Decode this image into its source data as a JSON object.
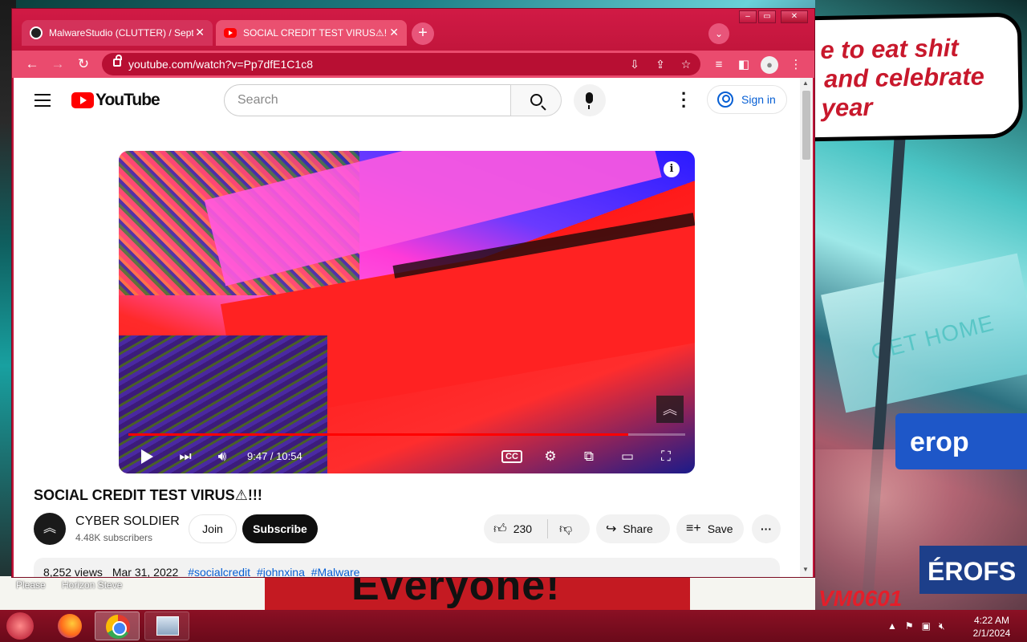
{
  "desktop": {
    "bubble_lines": [
      "e to eat shit",
      "and celebrate",
      "year"
    ],
    "billboard_text": "GET HOME",
    "sign_text_1": "erop",
    "sign_text_2": "ÉROFS",
    "banner_text": "Everyone!",
    "corner_text": "VM0601",
    "icon_labels": [
      "Please",
      "Horizon Steve"
    ]
  },
  "browser": {
    "tabs": [
      {
        "label": "MalwareStudio (CLUTTER) / Sept..."
      },
      {
        "label": "SOCIAL CREDIT TEST VIRUS⚠!!! -"
      }
    ],
    "new_tab_label": "+",
    "url": "youtube.com/watch?v=Pp7dfE1C1c8"
  },
  "youtube": {
    "logo_text": "YouTube",
    "search_placeholder": "Search",
    "sign_in_label": "Sign in",
    "player": {
      "time": "9:47 / 10:54",
      "progress_fraction": 0.898,
      "cc_label": "CC"
    },
    "video": {
      "title": "SOCIAL CREDIT TEST VIRUS⚠!!!",
      "channel_name": "CYBER SOLDIER",
      "subscribers": "4.48K subscribers",
      "join_label": "Join",
      "subscribe_label": "Subscribe",
      "like_count": "230",
      "share_label": "Share",
      "save_label": "Save"
    },
    "description": {
      "views": "8,252 views",
      "date": "Mar 31, 2022",
      "tags": [
        "#socialcredit",
        "#johnxina",
        "#Malware"
      ]
    }
  },
  "taskbar": {
    "time": "4:22 AM",
    "date": "2/1/2024"
  }
}
